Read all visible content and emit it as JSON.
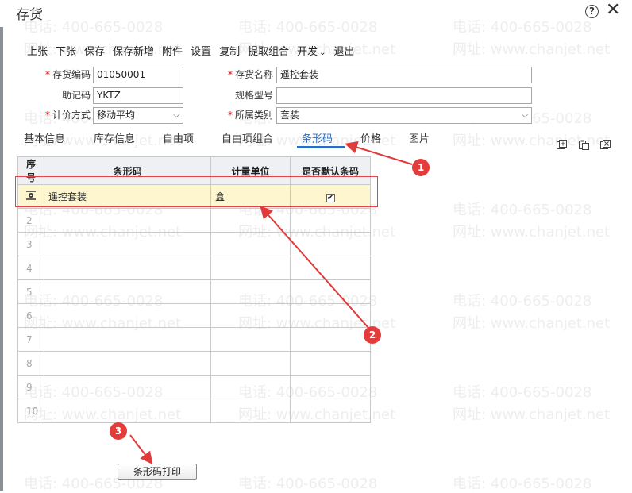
{
  "window": {
    "title": "存货"
  },
  "toolbar": {
    "items": [
      "上张",
      "下张",
      "保存",
      "保存新增",
      "附件",
      "设置",
      "复制",
      "提取组合",
      "开发",
      "退出"
    ]
  },
  "form": {
    "code_label": "存货编码",
    "code_value": "01050001",
    "name_label": "存货名称",
    "name_value": "遥控套装",
    "mnemonic_label": "助记码",
    "mnemonic_value": "YKTZ",
    "spec_label": "规格型号",
    "spec_value": "",
    "pricing_label": "计价方式",
    "pricing_value": "移动平均",
    "category_label": "所属类别",
    "category_value": "套装"
  },
  "tabs": [
    "基本信息",
    "库存信息",
    "自由项",
    "自由项组合",
    "条形码",
    "价格",
    "图片"
  ],
  "active_tab": "条形码",
  "grid": {
    "headers": [
      "序号",
      "条形码",
      "计量单位",
      "是否默认条码"
    ],
    "row1": {
      "barcode": "遥控套装",
      "unit": "盒",
      "default": "✔"
    },
    "row_numbers": [
      "2",
      "3",
      "4",
      "5",
      "6",
      "7",
      "8",
      "9",
      "10"
    ]
  },
  "print_button": "条形码打印",
  "badges": [
    "1",
    "2",
    "3"
  ],
  "watermark": {
    "phone": "电话: 400-665-0028",
    "site": "网址: www.chanjet.net"
  },
  "colors": {
    "accent": "#2a6cc8",
    "highlight": "#e0454a",
    "selected_row": "#fdf6cf",
    "required_star": "#dd0000"
  }
}
